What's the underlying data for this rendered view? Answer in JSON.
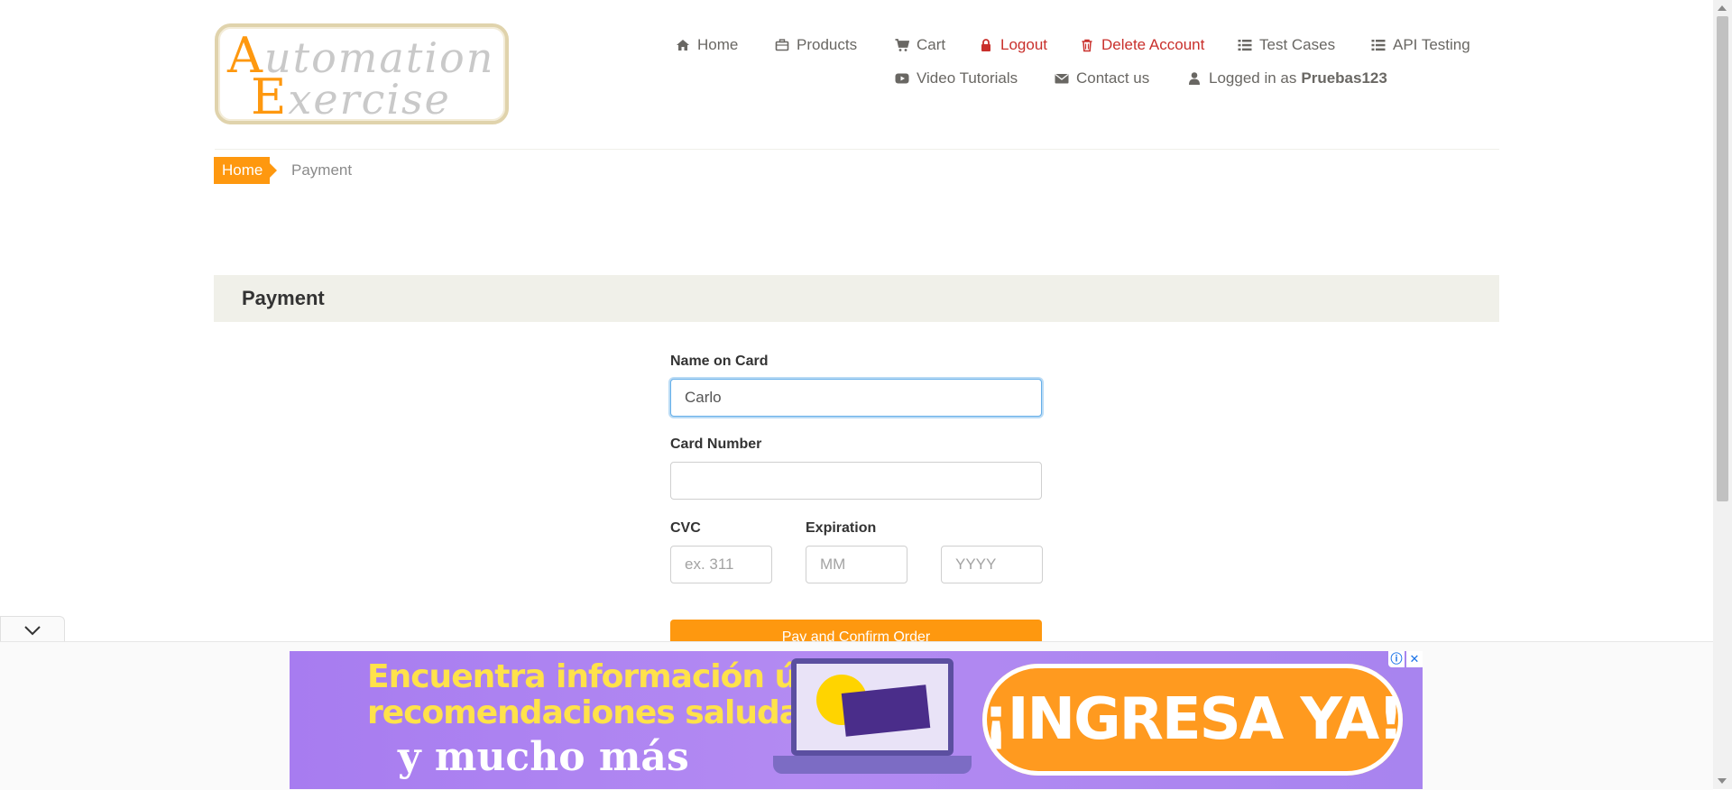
{
  "logo": {
    "line1_first": "A",
    "line1_rest": "utomation",
    "line2_first": "E",
    "line2_rest": "xercise"
  },
  "nav": {
    "home": "Home",
    "products": "Products",
    "cart": "Cart",
    "logout": "Logout",
    "delete_account": "Delete Account",
    "test_cases": "Test Cases",
    "api_testing": "API Testing",
    "video_tutorials": "Video Tutorials",
    "contact_us": "Contact us",
    "logged_in_prefix": "Logged in as",
    "username": "Pruebas123"
  },
  "breadcrumb": {
    "home": "Home",
    "current": "Payment"
  },
  "panel": {
    "title": "Payment"
  },
  "form": {
    "name_label": "Name on Card",
    "name_value": "Carlo",
    "card_number_label": "Card Number",
    "card_number_value": "",
    "cvc_label": "CVC",
    "cvc_placeholder": "ex. 311",
    "expiration_label": "Expiration",
    "month_placeholder": "MM",
    "year_placeholder": "YYYY",
    "submit_label": "Pay and Confirm Order"
  },
  "ad": {
    "line1": "Encuentra información útil,",
    "line2": "recomendaciones saludables",
    "line3": "y mucho más",
    "cta": "¡INGRESA YA!",
    "info_icon": "ⓘ",
    "close_icon": "✕"
  },
  "colors": {
    "accent": "#fe980f",
    "danger": "#c9302c",
    "panel": "#f0f0e9",
    "focus": "#66afe9"
  }
}
